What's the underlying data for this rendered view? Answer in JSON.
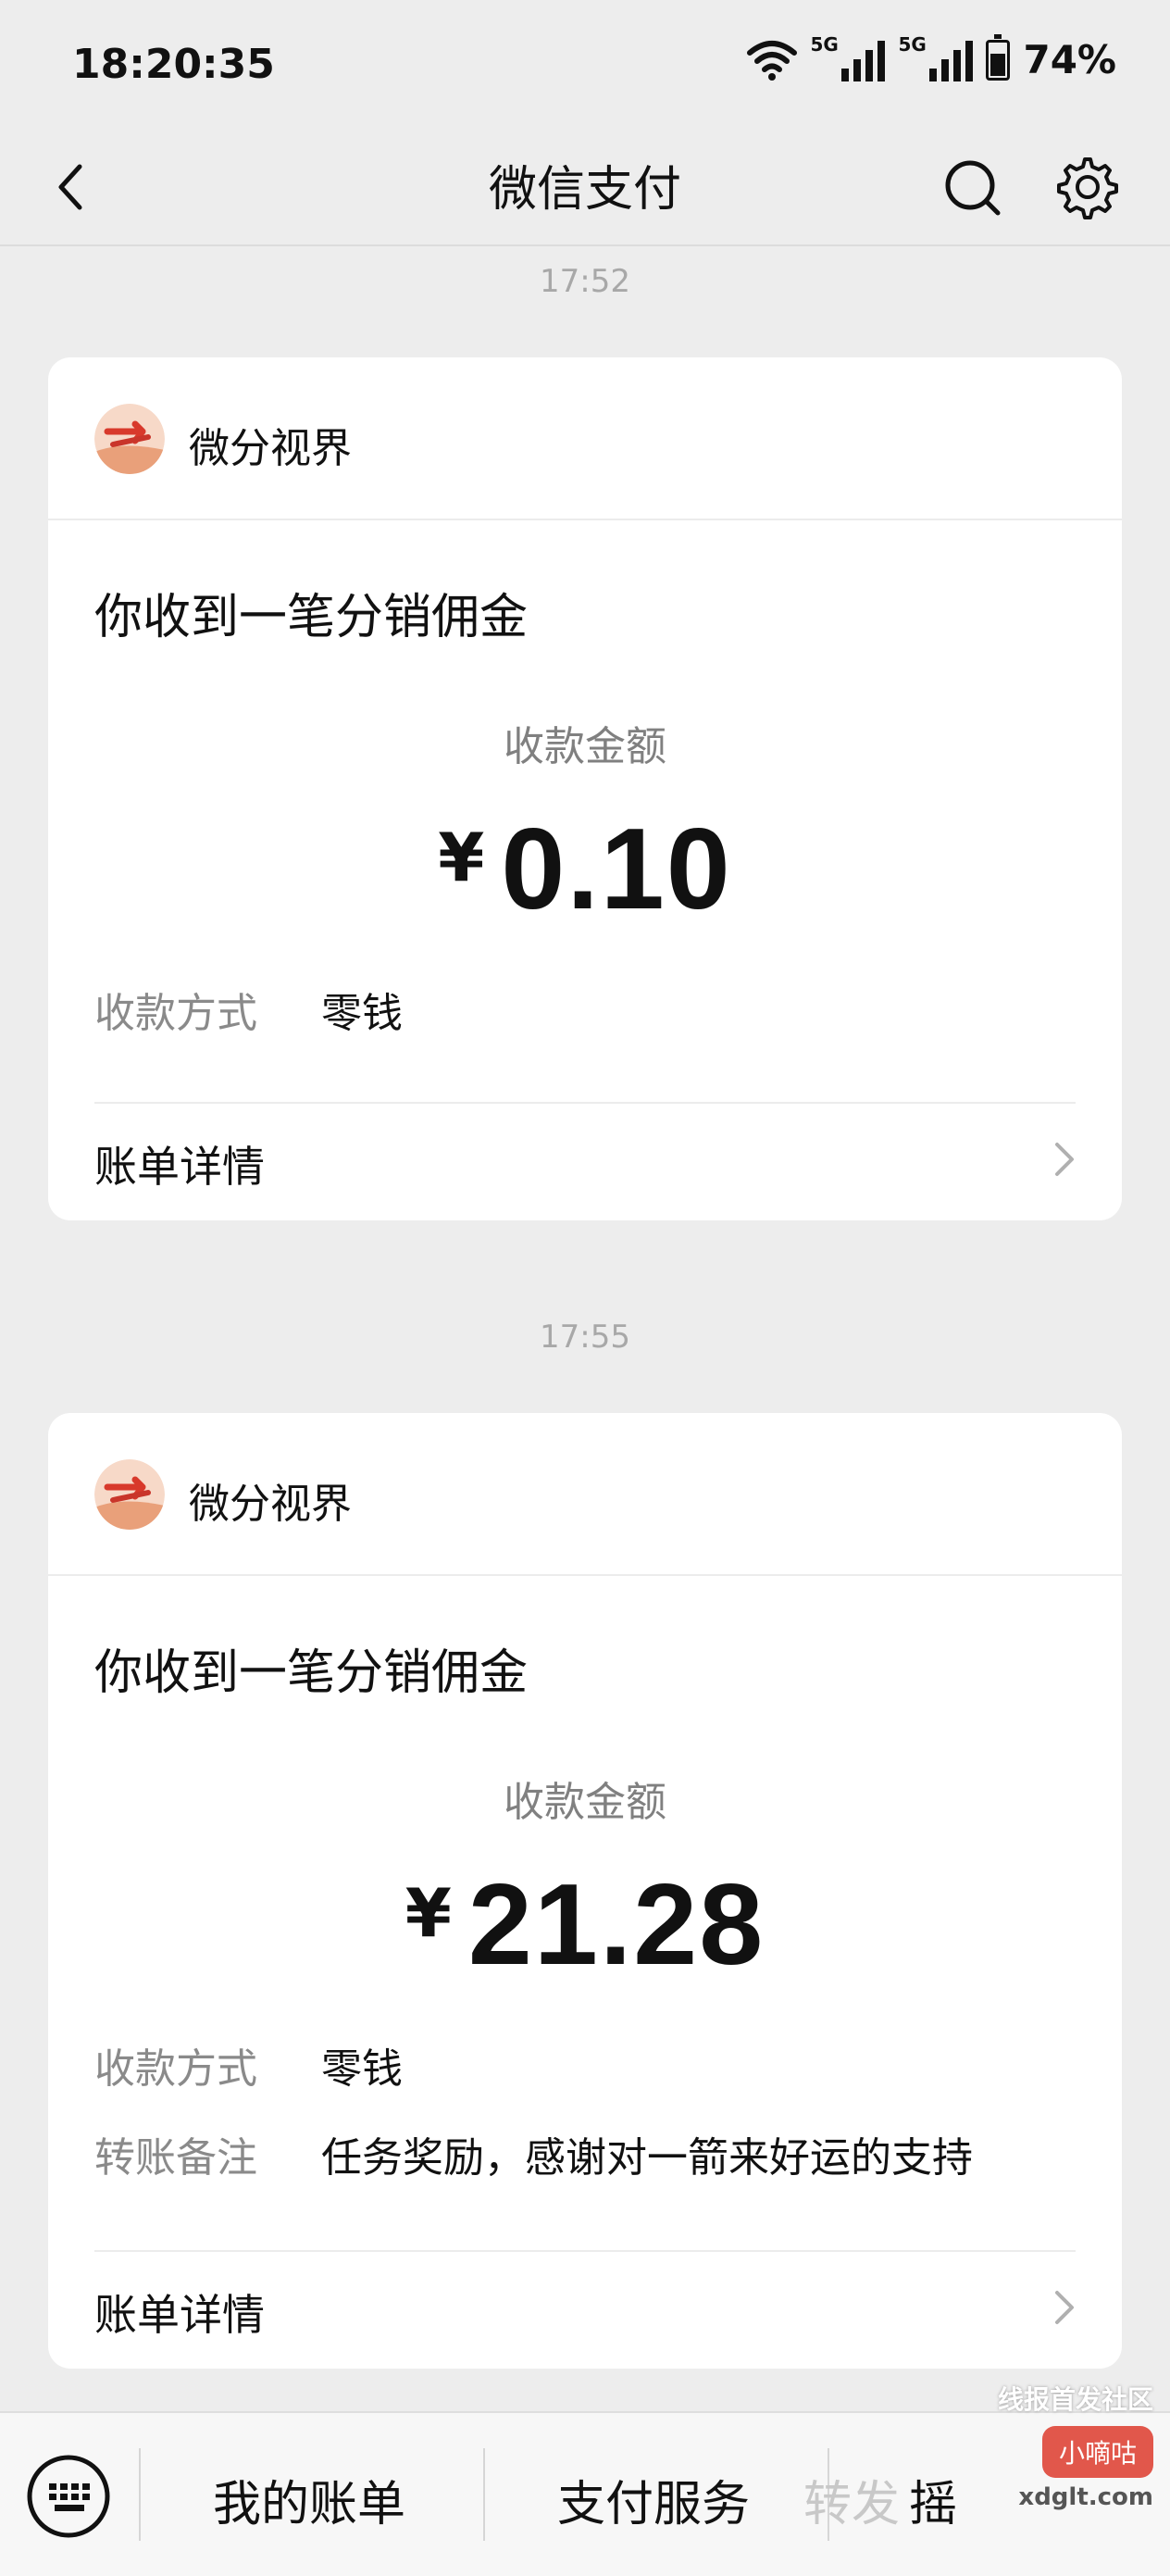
{
  "status_bar": {
    "time": "18:20:35",
    "network_1": "5G",
    "network_2": "5G",
    "battery": "74%"
  },
  "nav": {
    "title": "微信支付",
    "back_icon": "chevron-left-icon",
    "search_icon": "search-icon",
    "settings_icon": "gear-icon"
  },
  "messages": [
    {
      "timestamp": "17:52",
      "sender": "微分视界",
      "title": "你收到一笔分销佣金",
      "amount_label": "收款金额",
      "currency": "¥",
      "amount": "0.10",
      "rows": [
        {
          "key": "收款方式",
          "value": "零钱"
        }
      ],
      "detail_label": "账单详情"
    },
    {
      "timestamp": "17:55",
      "sender": "微分视界",
      "title": "你收到一笔分销佣金",
      "amount_label": "收款金额",
      "currency": "¥",
      "amount": "21.28",
      "rows": [
        {
          "key": "收款方式",
          "value": "零钱"
        },
        {
          "key": "转账备注",
          "value": "任务奖励，感谢对一箭来好运的支持"
        }
      ],
      "detail_label": "账单详情"
    }
  ],
  "bottom_bar": {
    "keyboard_icon": "keyboard-icon",
    "tabs": [
      "我的账单",
      "支付服务",
      "转发",
      "摇"
    ]
  },
  "watermark": {
    "line1": "线报首发社区",
    "badge": "小嘀咕",
    "url": "xdglt.com"
  }
}
